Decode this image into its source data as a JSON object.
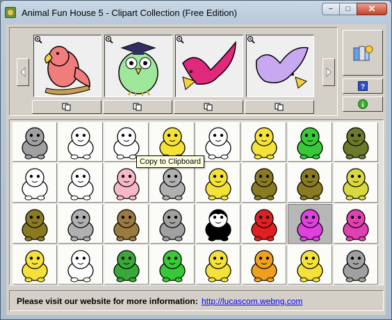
{
  "window": {
    "title": "Animal Fun House 5 - Clipart Collection (Free Edition)",
    "caption_buttons": {
      "minimize": "−",
      "maximize": "□",
      "close": "✕"
    }
  },
  "toolbar": {
    "prev_icon": "left-arrow-icon",
    "next_icon": "right-arrow-icon",
    "previews": [
      {
        "name": "parrot-on-branch",
        "color": "#f07c7c",
        "icon": "zoom-icon"
      },
      {
        "name": "graduate-owl",
        "color": "#9fe89b",
        "icon": "zoom-icon"
      },
      {
        "name": "flying-magenta-bird",
        "color": "#e0287c",
        "icon": "zoom-icon"
      },
      {
        "name": "flying-lavender-bird",
        "color": "#c8a8f0",
        "icon": "zoom-icon"
      }
    ],
    "copy_icon": "copy-to-clipboard-icon",
    "side_buttons": [
      "library-icon",
      "help-icon",
      "info-icon"
    ]
  },
  "gallery": {
    "tooltip": "Copy to Clipboard",
    "selected_index": 22,
    "cells": [
      {
        "name": "koala-gray",
        "color": "#a0a0a0"
      },
      {
        "name": "rabbit",
        "color": "#ffffff"
      },
      {
        "name": "white-dog",
        "color": "#ffffff"
      },
      {
        "name": "yellow-dog",
        "color": "#f4e13a"
      },
      {
        "name": "rooster",
        "color": "#ffffff"
      },
      {
        "name": "penguin-duck",
        "color": "#f4e13a"
      },
      {
        "name": "green-frog",
        "color": "#38c838"
      },
      {
        "name": "turtle",
        "color": "#6b7a2a"
      },
      {
        "name": "panda",
        "color": "#ffffff"
      },
      {
        "name": "cow",
        "color": "#ffffff"
      },
      {
        "name": "pig",
        "color": "#f8b8c8"
      },
      {
        "name": "donkey",
        "color": "#b0b0b0"
      },
      {
        "name": "giraffe",
        "color": "#f4e13a"
      },
      {
        "name": "deer",
        "color": "#8a7a20"
      },
      {
        "name": "kangaroo",
        "color": "#8a7a20"
      },
      {
        "name": "owl",
        "color": "#d8d840"
      },
      {
        "name": "squirrel",
        "color": "#8a7a20"
      },
      {
        "name": "koala-tree",
        "color": "#b0b0b0"
      },
      {
        "name": "bear",
        "color": "#9a7a40"
      },
      {
        "name": "raccoon",
        "color": "#a0a0a0"
      },
      {
        "name": "penguin",
        "color": "#000000"
      },
      {
        "name": "ladybug",
        "color": "#e02020"
      },
      {
        "name": "magenta-bird",
        "color": "#e040e0"
      },
      {
        "name": "fish",
        "color": "#e040b0"
      },
      {
        "name": "tiger",
        "color": "#f4e13a"
      },
      {
        "name": "elephant",
        "color": "#ffffff"
      },
      {
        "name": "crocodile",
        "color": "#38a838"
      },
      {
        "name": "crab",
        "color": "#38c838"
      },
      {
        "name": "hippo",
        "color": "#f4e13a"
      },
      {
        "name": "lion",
        "color": "#f0a020"
      },
      {
        "name": "sheep",
        "color": "#f4e13a"
      },
      {
        "name": "monkey",
        "color": "#a0a0a0"
      }
    ]
  },
  "footer": {
    "message": "Please visit our website for more information:",
    "link": "http://lucascom.webng.com"
  }
}
